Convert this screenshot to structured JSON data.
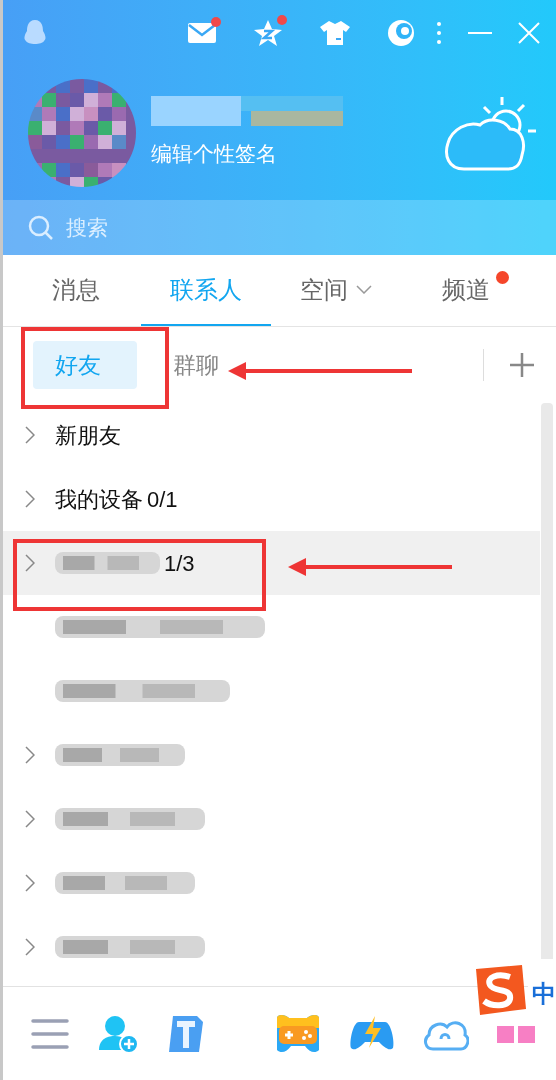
{
  "top_icons": [
    {
      "kind": "mail",
      "badge": true
    },
    {
      "kind": "star",
      "badge": true
    },
    {
      "kind": "shirt"
    },
    {
      "kind": "moon"
    }
  ],
  "profile": {
    "signature": "编辑个性签名"
  },
  "search": {
    "placeholder": "搜索"
  },
  "tabs": [
    {
      "label": "消息",
      "selected": false
    },
    {
      "label": "联系人",
      "selected": true
    },
    {
      "label": "空间",
      "selected": false,
      "dropdown": true
    },
    {
      "label": "频道",
      "selected": false,
      "badge": true
    }
  ],
  "subtabs": [
    {
      "label": "好友",
      "selected": true
    },
    {
      "label": "群聊",
      "selected": false
    }
  ],
  "rows": [
    {
      "kind": "group",
      "label": "新朋友",
      "selected": false
    },
    {
      "kind": "group",
      "label": "我的设备",
      "count": "0/1",
      "selected": false
    },
    {
      "kind": "group",
      "redacted": true,
      "count": "1/3",
      "selected": true
    },
    {
      "kind": "contact",
      "redacted": true,
      "selected": false
    },
    {
      "kind": "contact",
      "redacted": true,
      "selected": false
    },
    {
      "kind": "group",
      "redacted": true,
      "selected": false
    },
    {
      "kind": "group",
      "redacted": true,
      "selected": false
    },
    {
      "kind": "group",
      "redacted": true,
      "selected": false
    },
    {
      "kind": "group",
      "redacted": true,
      "selected": false
    }
  ],
  "bottom_icons": [
    {
      "kind": "menu"
    },
    {
      "kind": "add-contact"
    },
    {
      "kind": "upload"
    },
    {
      "kind": "game"
    },
    {
      "kind": "lightning"
    },
    {
      "kind": "cloud"
    },
    {
      "kind": "apps"
    }
  ],
  "ime": {
    "label": "中"
  }
}
